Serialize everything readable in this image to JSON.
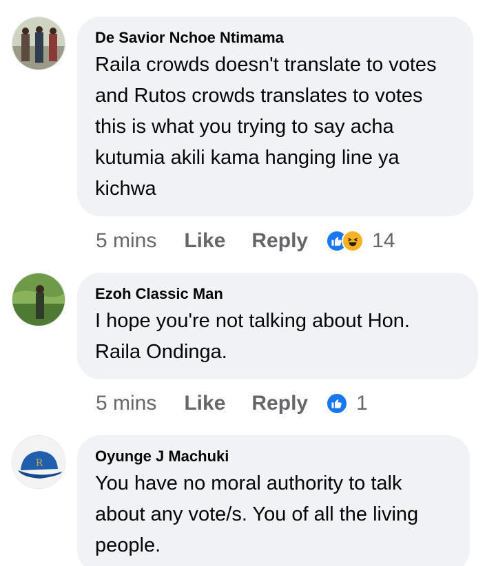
{
  "comments": [
    {
      "author": "De Savior Nchoe Ntimama",
      "text": "Raila crowds doesn't translate to votes and Rutos crowds translates to votes this is what you trying to say acha kutumia akili kama hanging line ya kichwa",
      "time": "5 mins",
      "like_label": "Like",
      "reply_label": "Reply",
      "reactions": [
        "like-icon",
        "haha-icon"
      ],
      "reaction_count": "14"
    },
    {
      "author": "Ezoh Classic Man",
      "text": "I hope you're not talking about Hon. Raila Ondinga.",
      "time": "5 mins",
      "like_label": "Like",
      "reply_label": "Reply",
      "reactions": [
        "like-icon"
      ],
      "reaction_count": "1"
    },
    {
      "author": "Oyunge J Machuki",
      "text": "You have no moral authority to talk about any vote/s. You of all the living people."
    }
  ],
  "colors": {
    "bubble": "#f0f2f5",
    "meta_text": "#65676b",
    "like_blue": "#1877f2",
    "haha_yellow": "#f7b125"
  }
}
